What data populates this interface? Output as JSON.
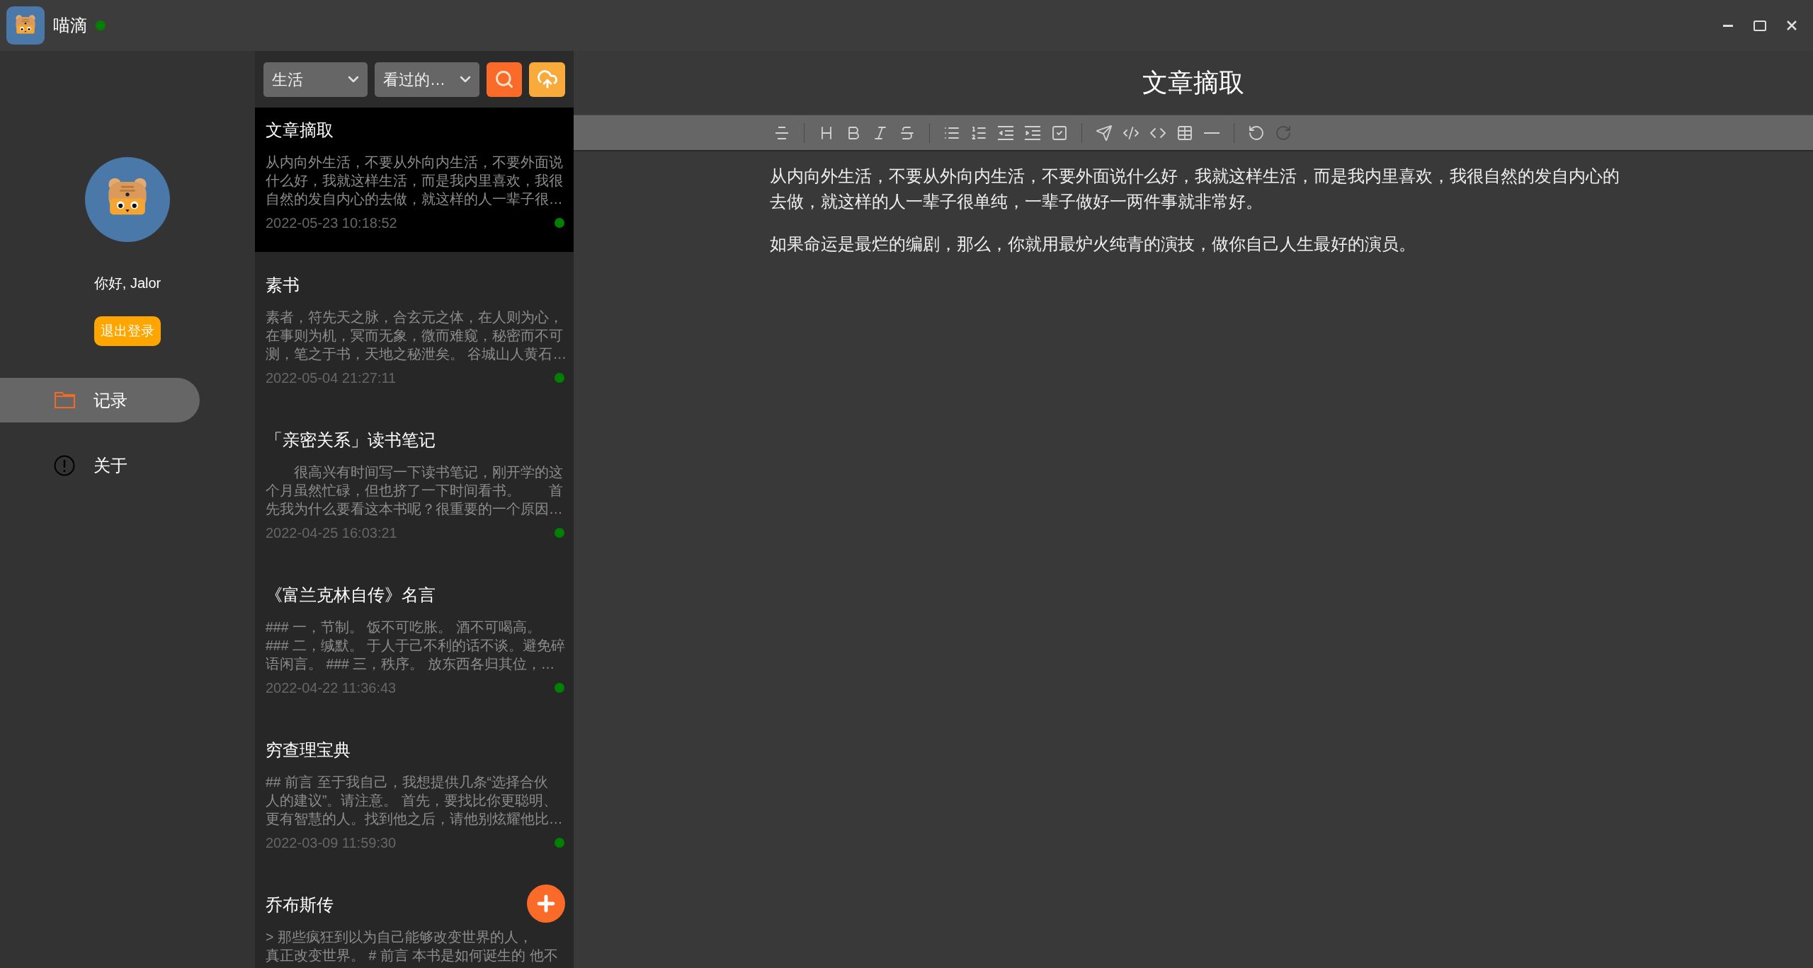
{
  "title_bar": {
    "app_name": "喵滴",
    "status_dot": {
      "color": "#008000"
    }
  },
  "sidebar": {
    "greeting": "你好, Jalor",
    "logout_button": "退出登录",
    "nav_items": [
      {
        "kind": "folder",
        "label": "记录",
        "selected": true
      },
      {
        "kind": "info",
        "label": "关于",
        "selected": false
      }
    ]
  },
  "note_list": {
    "filters": [
      {
        "value": "生活"
      },
      {
        "value": "看过的…"
      }
    ],
    "notes": [
      {
        "title": "文章摘取",
        "snippet_lines": [
          "从内向外生活，不要从外向内生活，不要外面说",
          "什么好，我就这样生活，而是我内里喜欢，我很",
          "自然的发自内心的去做，就这样的人一辈子很…"
        ],
        "date": "2022-05-23 10:18:52",
        "status_dot": {
          "color": "#008000"
        },
        "selected": true
      },
      {
        "title": "素书",
        "snippet_lines": [
          "素者，符先天之脉，合玄元之体，在人则为心，",
          "在事则为机，冥而无象，微而难窥，秘密而不可",
          "测，笔之于书，天地之秘泄矣。 谷城山人黄石…"
        ],
        "date": "2022-05-04 21:27:11",
        "status_dot": {
          "color": "#008000"
        },
        "selected": false
      },
      {
        "title": "「亲密关系」读书笔记",
        "snippet_lines": [
          "　　很高兴有时间写一下读书笔记，刚开学的这",
          "个月虽然忙碌，但也挤了一下时间看书。　　首",
          "先我为什么要看这本书呢？很重要的一个原因…"
        ],
        "date": "2022-04-25 16:03:21",
        "status_dot": {
          "color": "#008000"
        },
        "selected": false
      },
      {
        "title": "《富兰克林自传》名言",
        "snippet_lines": [
          "### 一，节制。 饭不可吃胀。 酒不可喝高。",
          "### 二，缄默。 于人于己不利的话不谈。避免碎",
          "语闲言。 ### 三，秩序。 放东西各归其位，…"
        ],
        "date": "2022-04-22 11:36:43",
        "status_dot": {
          "color": "#008000"
        },
        "selected": false
      },
      {
        "title": "穷查理宝典",
        "snippet_lines": [
          "## 前言 至于我自己，我想提供几条“选择合伙",
          "人的建议”。请注意。 首先，要找比你更聪明、",
          "更有智慧的人。找到他之后，请他别炫耀他比…"
        ],
        "date": "2022-03-09 11:59:30",
        "status_dot": {
          "color": "#008000"
        },
        "selected": false
      },
      {
        "title": "乔布斯传",
        "snippet_lines": [
          "> 那些疯狂到以为自己能够改变世界的人，",
          "真正改变世界。 # 前言 本书是如何诞生的 他不"
        ],
        "selected": false
      }
    ]
  },
  "editor": {
    "title": "文章摘取",
    "toolbar": {
      "undo": {
        "disabled": false
      },
      "redo": {
        "disabled": true
      }
    },
    "paragraphs": [
      "从内向外生活，不要从外向内生活，不要外面说什么好，我就这样生活，而是我内里喜欢，我很自然的发自内心的去做，就这样的人一辈子很单纯，一辈子做好一两件事就非常好。",
      "如果命运是最烂的编剧，那么，你就用最炉火纯青的演技，做你自己人生最好的演员。"
    ]
  }
}
